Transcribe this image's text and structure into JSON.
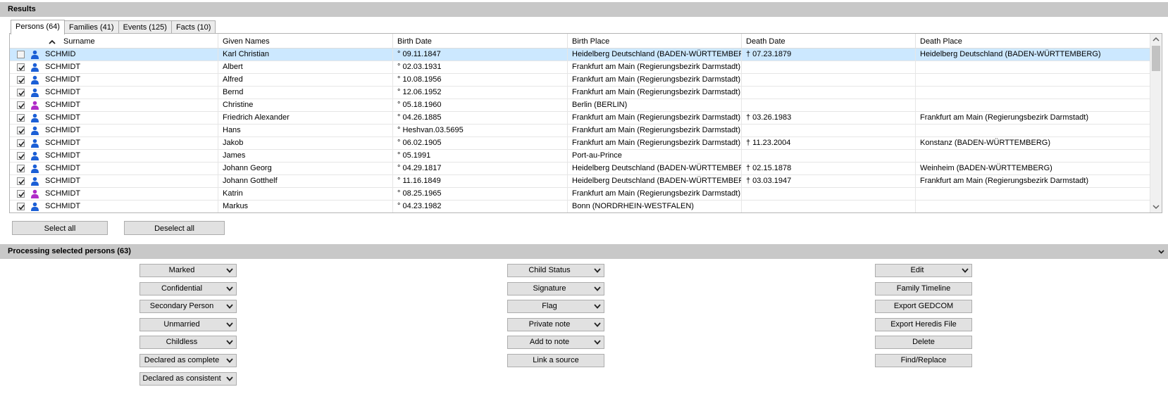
{
  "results_header": "Results",
  "tabs": [
    {
      "label": "Persons (64)",
      "active": true
    },
    {
      "label": "Families (41)",
      "active": false
    },
    {
      "label": "Events (125)",
      "active": false
    },
    {
      "label": "Facts (10)",
      "active": false
    }
  ],
  "columns": [
    "Surname",
    "Given Names",
    "Birth Date",
    "Birth Place",
    "Death Date",
    "Death Place"
  ],
  "sort_icon": "sort-ascending-icon",
  "colors": {
    "male": "#1b5fd6",
    "female": "#b02cc8",
    "selection": "#cce8ff",
    "header_bar": "#c8c8c8"
  },
  "rows": [
    {
      "checked": false,
      "gender": "male",
      "selected": true,
      "surname": "SCHMID",
      "given": "Karl Christian",
      "birth_date": "° 09.11.1847",
      "birth_place": "Heidelberg Deutschland (BADEN-WÜRTTEMBERG)",
      "death_date": "† 07.23.1879",
      "death_place": "Heidelberg Deutschland (BADEN-WÜRTTEMBERG)"
    },
    {
      "checked": true,
      "gender": "male",
      "surname": "SCHMIDT",
      "given": "Albert",
      "birth_date": "° 02.03.1931",
      "birth_place": "Frankfurt am Main (Regierungsbezirk Darmstadt)",
      "death_date": "",
      "death_place": ""
    },
    {
      "checked": true,
      "gender": "male",
      "surname": "SCHMIDT",
      "given": "Alfred",
      "birth_date": "° 10.08.1956",
      "birth_place": "Frankfurt am Main (Regierungsbezirk Darmstadt)",
      "death_date": "",
      "death_place": ""
    },
    {
      "checked": true,
      "gender": "male",
      "surname": "SCHMIDT",
      "given": "Bernd",
      "birth_date": "° 12.06.1952",
      "birth_place": "Frankfurt am Main (Regierungsbezirk Darmstadt)",
      "death_date": "",
      "death_place": ""
    },
    {
      "checked": true,
      "gender": "female",
      "surname": "SCHMIDT",
      "given": "Christine",
      "birth_date": "° 05.18.1960",
      "birth_place": "Berlin (BERLIN)",
      "death_date": "",
      "death_place": ""
    },
    {
      "checked": true,
      "gender": "male",
      "surname": "SCHMIDT",
      "given": "Friedrich Alexander",
      "birth_date": "° 04.26.1885",
      "birth_place": "Frankfurt am Main (Regierungsbezirk Darmstadt)",
      "death_date": "† 03.26.1983",
      "death_place": "Frankfurt am Main (Regierungsbezirk Darmstadt)"
    },
    {
      "checked": true,
      "gender": "male",
      "surname": "SCHMIDT",
      "given": "Hans",
      "birth_date": "° Heshvan.03.5695",
      "birth_place": "Frankfurt am Main (Regierungsbezirk Darmstadt)",
      "death_date": "",
      "death_place": ""
    },
    {
      "checked": true,
      "gender": "male",
      "surname": "SCHMIDT",
      "given": "Jakob",
      "birth_date": "° 06.02.1905",
      "birth_place": "Frankfurt am Main (Regierungsbezirk Darmstadt)",
      "death_date": "† 11.23.2004",
      "death_place": "Konstanz (BADEN-WÜRTTEMBERG)"
    },
    {
      "checked": true,
      "gender": "male",
      "surname": "SCHMIDT",
      "given": "James",
      "birth_date": "° 05.1991",
      "birth_place": "Port-au-Prince",
      "death_date": "",
      "death_place": ""
    },
    {
      "checked": true,
      "gender": "male",
      "surname": "SCHMIDT",
      "given": "Johann Georg",
      "birth_date": "° 04.29.1817",
      "birth_place": "Heidelberg Deutschland (BADEN-WÜRTTEMBERG)",
      "death_date": "† 02.15.1878",
      "death_place": "Weinheim (BADEN-WÜRTTEMBERG)"
    },
    {
      "checked": true,
      "gender": "male",
      "surname": "SCHMIDT",
      "given": "Johann Gotthelf",
      "birth_date": "° 11.16.1849",
      "birth_place": "Heidelberg Deutschland (BADEN-WÜRTTEMBERG)",
      "death_date": "† 03.03.1947",
      "death_place": "Frankfurt am Main (Regierungsbezirk Darmstadt)"
    },
    {
      "checked": true,
      "gender": "female",
      "surname": "SCHMIDT",
      "given": "Katrin",
      "birth_date": "° 08.25.1965",
      "birth_place": "Frankfurt am Main (Regierungsbezirk Darmstadt)",
      "death_date": "",
      "death_place": ""
    },
    {
      "checked": true,
      "gender": "male",
      "surname": "SCHMIDT",
      "given": "Markus",
      "birth_date": "° 04.23.1982",
      "birth_place": "Bonn (NORDRHEIN-WESTFALEN)",
      "death_date": "",
      "death_place": ""
    }
  ],
  "buttons": {
    "select_all": "Select all",
    "deselect_all": "Deselect all"
  },
  "processing_header": "Processing selected persons (63)",
  "actions": {
    "col1": [
      {
        "label": "Marked",
        "dropdown": true
      },
      {
        "label": "Confidential",
        "dropdown": true
      },
      {
        "label": "Secondary Person",
        "dropdown": true
      },
      {
        "label": "Unmarried",
        "dropdown": true
      },
      {
        "label": "Childless",
        "dropdown": true
      },
      {
        "label": "Declared as complete",
        "dropdown": true
      },
      {
        "label": "Declared as consistent",
        "dropdown": true
      }
    ],
    "col2": [
      {
        "label": "Child Status",
        "dropdown": true
      },
      {
        "label": "Signature",
        "dropdown": true
      },
      {
        "label": "Flag",
        "dropdown": true
      },
      {
        "label": "Private note",
        "dropdown": true
      },
      {
        "label": "Add to note",
        "dropdown": true
      },
      {
        "label": "Link a source",
        "dropdown": false
      }
    ],
    "col3": [
      {
        "label": "Edit",
        "dropdown": true
      },
      {
        "label": "Family Timeline",
        "dropdown": false
      },
      {
        "label": "Export GEDCOM",
        "dropdown": false
      },
      {
        "label": "Export Heredis File",
        "dropdown": false
      },
      {
        "label": "Delete",
        "dropdown": false
      },
      {
        "label": "Find/Replace",
        "dropdown": false
      }
    ]
  }
}
